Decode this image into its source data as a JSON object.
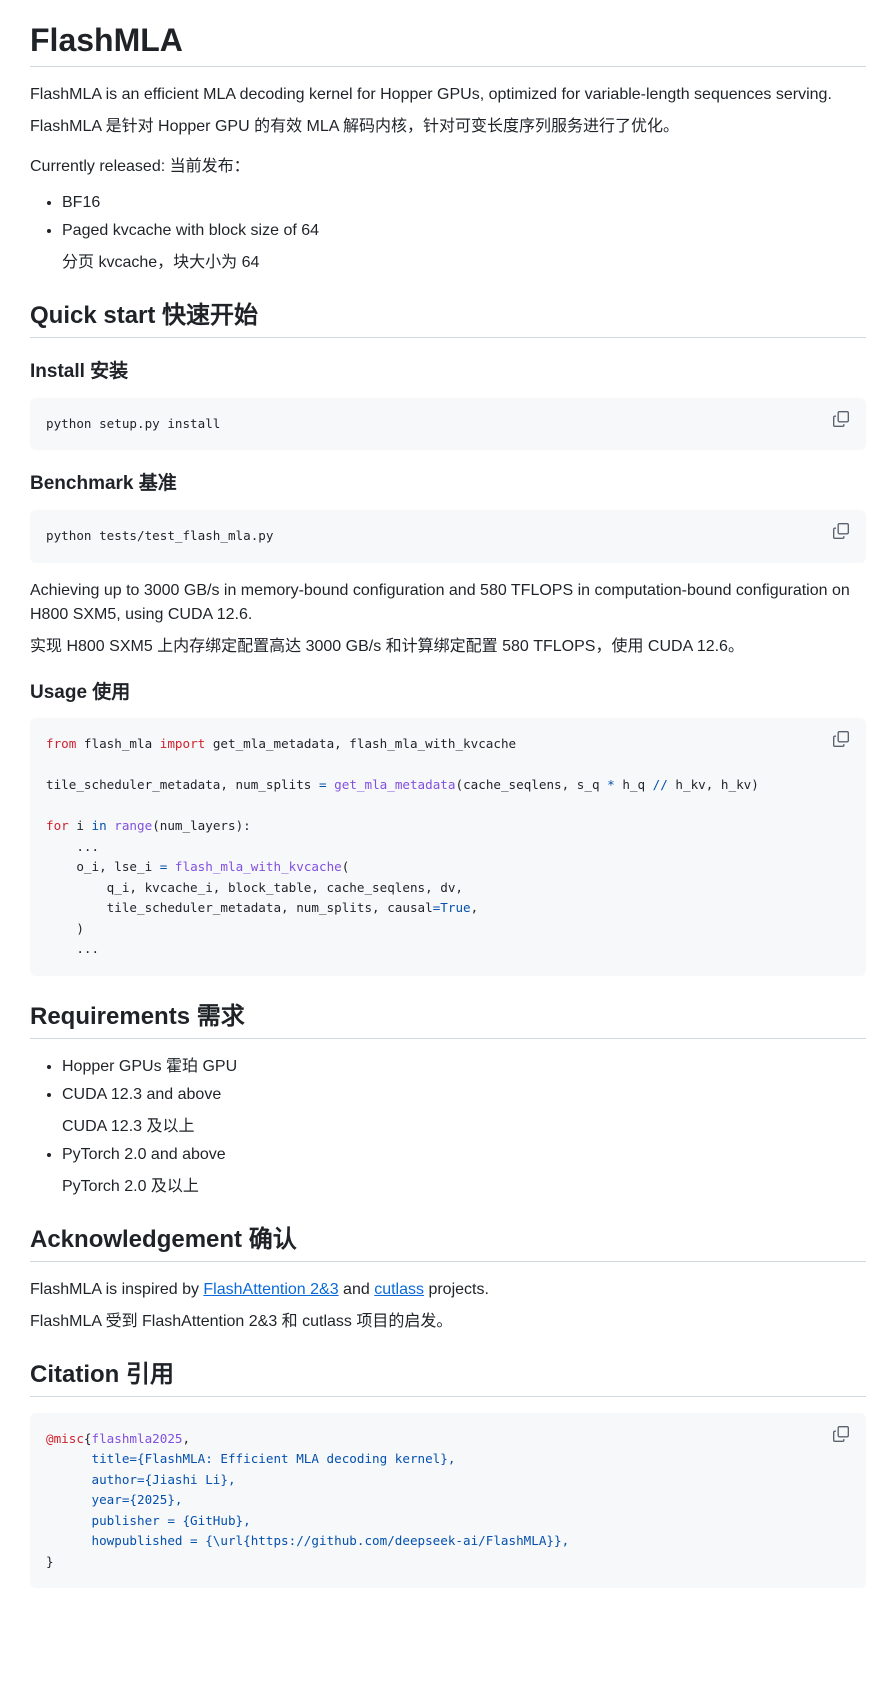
{
  "title": "FlashMLA",
  "intro": [
    "FlashMLA is an efficient MLA decoding kernel for Hopper GPUs, optimized for variable-length sequences serving.",
    "FlashMLA 是针对 Hopper GPU 的有效 MLA 解码内核，针对可变长度序列服务进行了优化。"
  ],
  "released_label": "Currently released:  当前发布：",
  "released": [
    {
      "text": "BF16"
    },
    {
      "text": "Paged kvcache with block size of 64",
      "sub": "分页 kvcache，块大小为 64"
    }
  ],
  "quick_start": "Quick start  快速开始",
  "install": {
    "heading": "Install  安装",
    "code": [
      [
        [
          "python setup.py install",
          ""
        ]
      ]
    ]
  },
  "benchmark": {
    "heading": "Benchmark  基准",
    "code": [
      [
        [
          "python tests/test_flash_mla.py",
          ""
        ]
      ]
    ],
    "text": [
      "Achieving up to 3000 GB/s in memory-bound configuration and 580 TFLOPS in computation-bound configuration on H800 SXM5, using CUDA 12.6.",
      "实现 H800 SXM5 上内存绑定配置高达 3000 GB/s 和计算绑定配置 580 TFLOPS，使用 CUDA 12.6。"
    ]
  },
  "usage": {
    "heading": "Usage  使用",
    "code": [
      [
        [
          "from",
          "k"
        ],
        [
          " flash_mla ",
          ""
        ],
        [
          "import",
          "k"
        ],
        [
          " get_mla_metadata, flash_mla_with_kvcache",
          ""
        ]
      ],
      [],
      [
        [
          "tile_scheduler_metadata, num_splits ",
          ""
        ],
        [
          "=",
          "c"
        ],
        [
          " ",
          ""
        ],
        [
          "get_mla_metadata",
          "f"
        ],
        [
          "(cache_seqlens, s_q ",
          ""
        ],
        [
          "*",
          "c"
        ],
        [
          " h_q ",
          ""
        ],
        [
          "//",
          "c"
        ],
        [
          " h_kv, h_kv)",
          ""
        ]
      ],
      [],
      [
        [
          "for",
          "k"
        ],
        [
          " i ",
          ""
        ],
        [
          "in",
          "c"
        ],
        [
          " ",
          ""
        ],
        [
          "range",
          "f"
        ],
        [
          "(num_layers):",
          ""
        ]
      ],
      [
        [
          "    ...",
          ""
        ]
      ],
      [
        [
          "    o_i, lse_i ",
          ""
        ],
        [
          "=",
          "c"
        ],
        [
          " ",
          ""
        ],
        [
          "flash_mla_with_kvcache",
          "f"
        ],
        [
          "(",
          ""
        ]
      ],
      [
        [
          "        q_i, kvcache_i, block_table, cache_seqlens, dv,",
          ""
        ]
      ],
      [
        [
          "        tile_scheduler_metadata, num_splits, causal",
          ""
        ],
        [
          "=",
          "c"
        ],
        [
          "True",
          "c"
        ],
        [
          ",",
          ""
        ]
      ],
      [
        [
          "    )",
          ""
        ]
      ],
      [
        [
          "    ...",
          ""
        ]
      ]
    ]
  },
  "requirements": {
    "heading": "Requirements  需求",
    "items": [
      {
        "text": "Hopper GPUs  霍珀 GPU"
      },
      {
        "text": "CUDA 12.3 and above",
        "sub": "CUDA 12.3 及以上"
      },
      {
        "text": "PyTorch 2.0 and above",
        "sub": "PyTorch 2.0 及以上"
      }
    ]
  },
  "ack": {
    "heading": "Acknowledgement  确认",
    "pre": "FlashMLA is inspired by ",
    "link1": "FlashAttention 2&3",
    "mid": " and ",
    "link2": "cutlass",
    "post": " projects.",
    "zh": "FlashMLA 受到 FlashAttention 2&3 和 cutlass 项目的启发。"
  },
  "citation": {
    "heading": "Citation  引用",
    "code": [
      [
        [
          "@misc",
          "k"
        ],
        [
          "{",
          ""
        ],
        [
          "flashmla2025",
          "f"
        ],
        [
          ",",
          ""
        ]
      ],
      [
        [
          "      title={FlashMLA: Efficient MLA decoding kernel},",
          "c"
        ]
      ],
      [
        [
          "      author={Jiashi Li},",
          "c"
        ]
      ],
      [
        [
          "      year={2025},",
          "c"
        ]
      ],
      [
        [
          "      publisher = {GitHub},",
          "c"
        ]
      ],
      [
        [
          "      howpublished = {\\url{https://github.com/deepseek-ai/FlashMLA}},",
          "c"
        ]
      ],
      [
        [
          "}",
          ""
        ]
      ]
    ]
  },
  "colors": {
    "link": "#0969da",
    "code_bg": "#f6f8fa",
    "keyword": "#cf222e",
    "function": "#8250df",
    "constant": "#0550ae"
  }
}
